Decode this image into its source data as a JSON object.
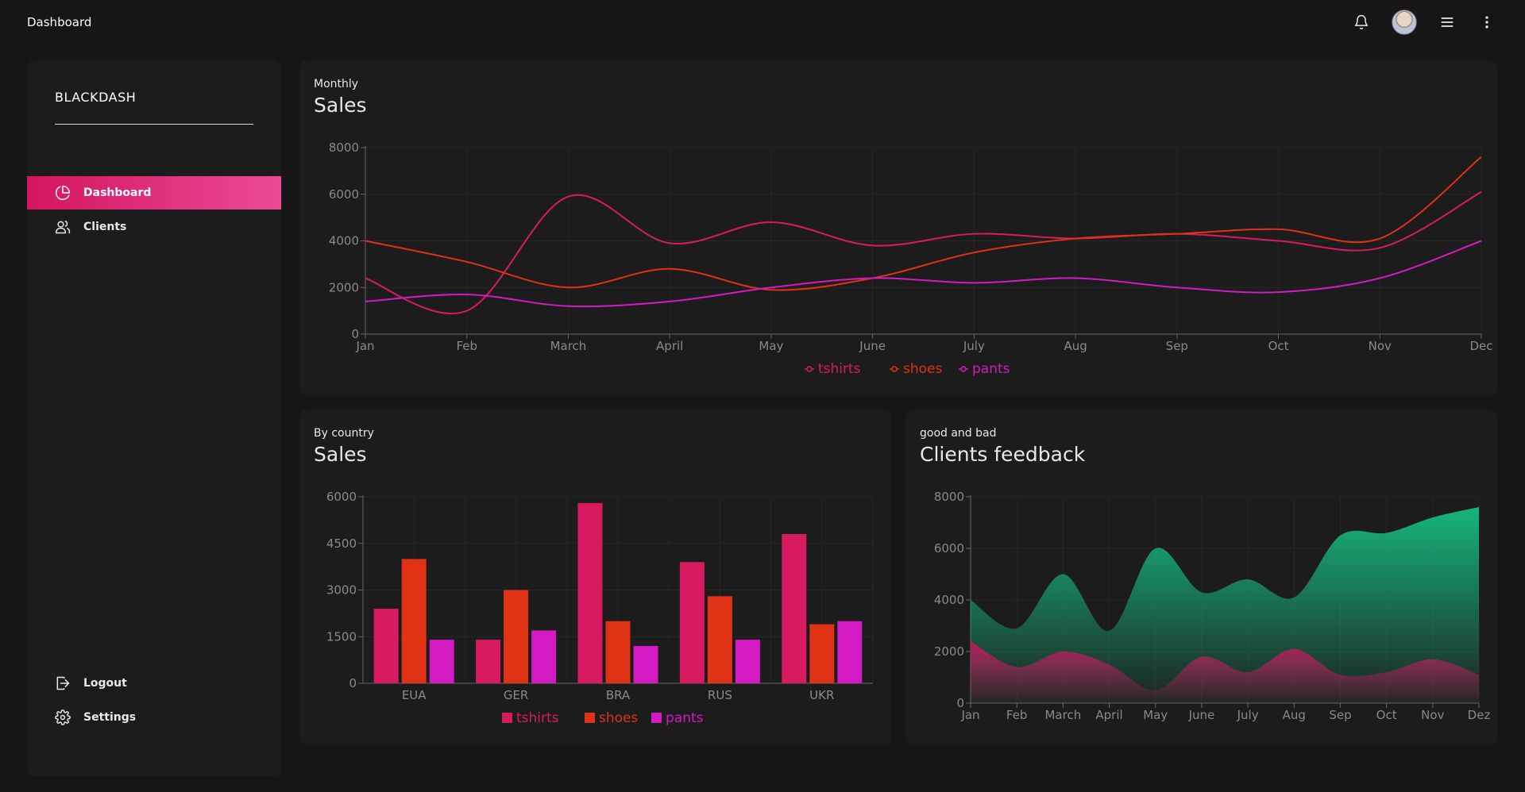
{
  "header": {
    "title": "Dashboard",
    "icons": [
      "bell-icon",
      "avatar",
      "menu-icon",
      "more-vertical-icon"
    ]
  },
  "sidebar": {
    "brand": "BLACKDASH",
    "items": [
      {
        "label": "Dashboard",
        "icon": "pie-chart-icon",
        "active": true
      },
      {
        "label": "Clients",
        "icon": "users-icon",
        "active": false
      }
    ],
    "bottom": [
      {
        "label": "Logout",
        "icon": "logout-icon"
      },
      {
        "label": "Settings",
        "icon": "gear-icon"
      }
    ]
  },
  "colors": {
    "accent": "#d4155f",
    "tshirts": "#d81b60",
    "shoes": "#e03214",
    "pants": "#d41ac2",
    "good": "#17b57c",
    "bad": "#b51f5c"
  },
  "cards": {
    "monthly": {
      "subtitle": "Monthly",
      "title": "Sales"
    },
    "country": {
      "subtitle": "By country",
      "title": "Sales"
    },
    "feedback": {
      "subtitle": "good and bad",
      "title": "Clients feedback"
    }
  },
  "chart_data": [
    {
      "type": "line",
      "categories": [
        "Jan",
        "Feb",
        "March",
        "April",
        "May",
        "June",
        "July",
        "Aug",
        "Sep",
        "Oct",
        "Nov",
        "Dec"
      ],
      "yticks": [
        0,
        2000,
        4000,
        6000,
        8000
      ],
      "ylim": [
        0,
        8000
      ],
      "grid": true,
      "legend": "bottom",
      "series": [
        {
          "name": "tshirts",
          "values": [
            2400,
            1000,
            5900,
            3900,
            4800,
            3800,
            4300,
            4100,
            4300,
            4000,
            3700,
            6100
          ]
        },
        {
          "name": "shoes",
          "values": [
            4000,
            3100,
            2000,
            2800,
            1900,
            2400,
            3500,
            4100,
            4300,
            4500,
            4100,
            7600
          ]
        },
        {
          "name": "pants",
          "values": [
            1400,
            1700,
            1200,
            1400,
            2000,
            2400,
            2200,
            2400,
            2000,
            1800,
            2400,
            4000
          ]
        }
      ]
    },
    {
      "type": "bar",
      "categories": [
        "EUA",
        "GER",
        "BRA",
        "RUS",
        "UKR"
      ],
      "yticks": [
        0,
        1500,
        3000,
        4500,
        6000
      ],
      "ylim": [
        0,
        6000
      ],
      "grid": true,
      "legend": "bottom",
      "series": [
        {
          "name": "tshirts",
          "values": [
            2400,
            1400,
            5800,
            3900,
            4800
          ]
        },
        {
          "name": "shoes",
          "values": [
            4000,
            3000,
            2000,
            2800,
            1900
          ]
        },
        {
          "name": "pants",
          "values": [
            1400,
            1700,
            1200,
            1400,
            2000
          ]
        }
      ]
    },
    {
      "type": "area",
      "categories": [
        "Jan",
        "Feb",
        "March",
        "April",
        "May",
        "June",
        "July",
        "Aug",
        "Sep",
        "Oct",
        "Nov",
        "Dez"
      ],
      "yticks": [
        0,
        2000,
        4000,
        6000,
        8000
      ],
      "ylim": [
        0,
        8000
      ],
      "grid": true,
      "series": [
        {
          "values": [
            4000,
            2900,
            5000,
            2800,
            6000,
            4300,
            4800,
            4100,
            6500,
            6600,
            7200,
            7600
          ]
        },
        {
          "values": [
            2400,
            1400,
            2000,
            1500,
            500,
            1800,
            1200,
            2100,
            1100,
            1200,
            1700,
            1100
          ]
        }
      ]
    }
  ]
}
